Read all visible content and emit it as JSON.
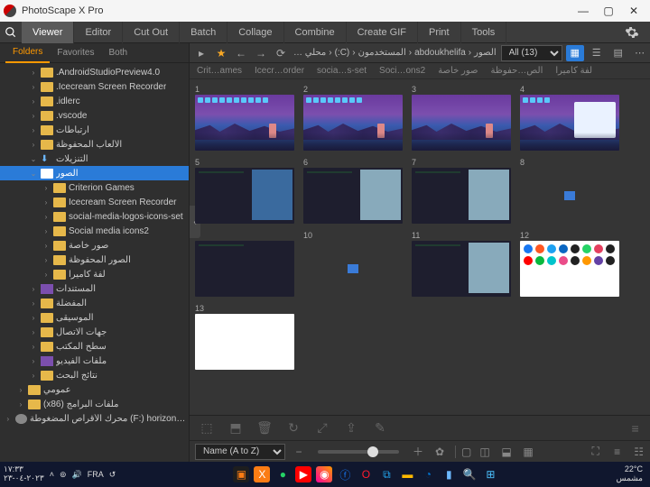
{
  "window": {
    "title": "PhotoScape X Pro"
  },
  "menu": {
    "items": [
      "Viewer",
      "Editor",
      "Cut Out",
      "Batch",
      "Collage",
      "Combine",
      "Create GIF",
      "Print",
      "Tools"
    ]
  },
  "sidebar": {
    "tabs": [
      "Folders",
      "Favorites",
      "Both"
    ],
    "nodes": [
      {
        "d": 2,
        "t": "f",
        "l": ".AndroidStudioPreview4.0"
      },
      {
        "d": 2,
        "t": "f",
        "l": ".Icecream Screen Recorder"
      },
      {
        "d": 2,
        "t": "f",
        "l": ".idlerc"
      },
      {
        "d": 2,
        "t": "f",
        "l": ".vscode"
      },
      {
        "d": 2,
        "t": "f",
        "l": "ارتباطات"
      },
      {
        "d": 2,
        "t": "f",
        "l": "الألعاب المحفوظة"
      },
      {
        "d": 2,
        "t": "d",
        "l": "التنزيلات",
        "open": true
      },
      {
        "d": 2,
        "t": "s",
        "l": "الصور",
        "sel": true,
        "open": true
      },
      {
        "d": 3,
        "t": "f",
        "l": "Criterion Games"
      },
      {
        "d": 3,
        "t": "f",
        "l": "Icecream Screen Recorder"
      },
      {
        "d": 3,
        "t": "f",
        "l": "social-media-logos-icons-set"
      },
      {
        "d": 3,
        "t": "f",
        "l": "Social media icons2"
      },
      {
        "d": 3,
        "t": "f",
        "l": "صور خاصة"
      },
      {
        "d": 3,
        "t": "f",
        "l": "الصور المحفوظة"
      },
      {
        "d": 3,
        "t": "f",
        "l": "لفة كاميرا"
      },
      {
        "d": 2,
        "t": "p",
        "l": "المستندات"
      },
      {
        "d": 2,
        "t": "f",
        "l": "المفضلة"
      },
      {
        "d": 2,
        "t": "f",
        "l": "الموسيقى"
      },
      {
        "d": 2,
        "t": "f",
        "l": "جهات الاتصال"
      },
      {
        "d": 2,
        "t": "f",
        "l": "سطح المكتب"
      },
      {
        "d": 2,
        "t": "p",
        "l": "ملفات الفيديو"
      },
      {
        "d": 2,
        "t": "f",
        "l": "نتائج البحث"
      },
      {
        "d": 1,
        "t": "f",
        "l": "عمومي"
      },
      {
        "d": 1,
        "t": "f",
        "l": "(x86) ملفات البرامج"
      },
      {
        "d": 0,
        "t": "v",
        "l": "محرك الأقراص المضغوطة (F:) horizonchas"
      }
    ]
  },
  "pathbar": {
    "crumbs": [
      "… محلي",
      "(:C)",
      "المستخدمون",
      "abdoukhelifa",
      "الصور"
    ],
    "filter_label": "All (13)"
  },
  "subcats": [
    "Crit…ames",
    "Icecr…order",
    "socia…s-set",
    "Soci…ons2",
    "صور خاصة",
    "الص…حفوظة",
    "لفة كاميرا"
  ],
  "thumbs": {
    "count": 13
  },
  "sort": {
    "label": "Name (A to Z)"
  },
  "taskbar": {
    "time": "١٧:٣٣",
    "date": "٢٠٢٣-٠٤-٢٣",
    "lang": "FRA",
    "temp": "22°C",
    "weather": "مشمس"
  }
}
